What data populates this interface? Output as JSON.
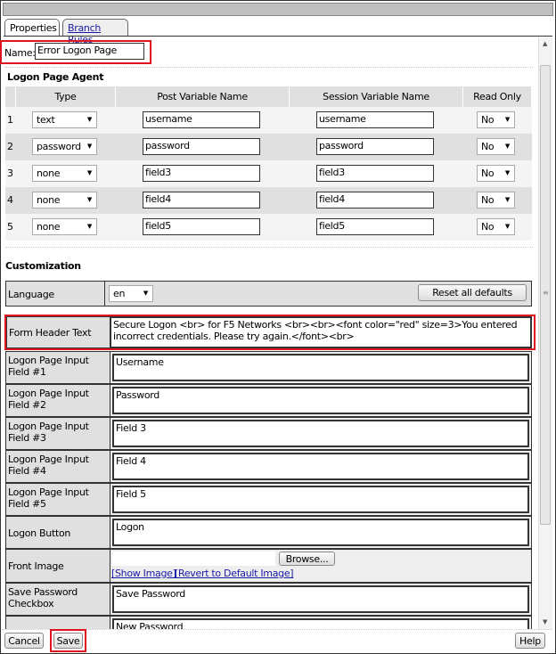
{
  "tabs": [
    {
      "label": "Properties"
    },
    {
      "label": "Branch Rules"
    }
  ],
  "name": {
    "label": "Name:",
    "value": "Error Logon Page"
  },
  "agent": {
    "title": "Logon Page Agent",
    "columns": [
      "Type",
      "Post Variable Name",
      "Session Variable Name",
      "Read Only"
    ],
    "rows": [
      {
        "n": "1",
        "type": "text",
        "post": "username",
        "session": "username",
        "ro": "No"
      },
      {
        "n": "2",
        "type": "password",
        "post": "password",
        "session": "password",
        "ro": "No"
      },
      {
        "n": "3",
        "type": "none",
        "post": "field3",
        "session": "field3",
        "ro": "No"
      },
      {
        "n": "4",
        "type": "none",
        "post": "field4",
        "session": "field4",
        "ro": "No"
      },
      {
        "n": "5",
        "type": "none",
        "post": "field5",
        "session": "field5",
        "ro": "No"
      }
    ]
  },
  "custom": {
    "title": "Customization",
    "language_label": "Language",
    "language": "en",
    "reset": "Reset all defaults",
    "form_header_label": "Form Header Text",
    "form_header": "Secure Logon <br> for F5 Networks <br><br><font color=\"red\" size=3>You entered incorrect credentials. Please try again.</font><br>",
    "fields": [
      {
        "label": "Logon Page Input Field #1",
        "value": "Username"
      },
      {
        "label": "Logon Page Input Field #2",
        "value": "Password"
      },
      {
        "label": "Logon Page Input Field #3",
        "value": "Field 3"
      },
      {
        "label": "Logon Page Input Field #4",
        "value": "Field 4"
      },
      {
        "label": "Logon Page Input Field #5",
        "value": "Field 5"
      },
      {
        "label": "Logon Button",
        "value": "Logon"
      }
    ],
    "front_image_label": "Front Image",
    "browse": "Browse...",
    "show_image": "[Show Image]",
    "revert_image": "[Revert to Default Image]",
    "save_pw_label": "Save Password Checkbox",
    "save_pw": "Save Password",
    "new_pw": "New Password"
  },
  "footer": {
    "cancel": "Cancel",
    "save": "Save",
    "help": "Help"
  }
}
